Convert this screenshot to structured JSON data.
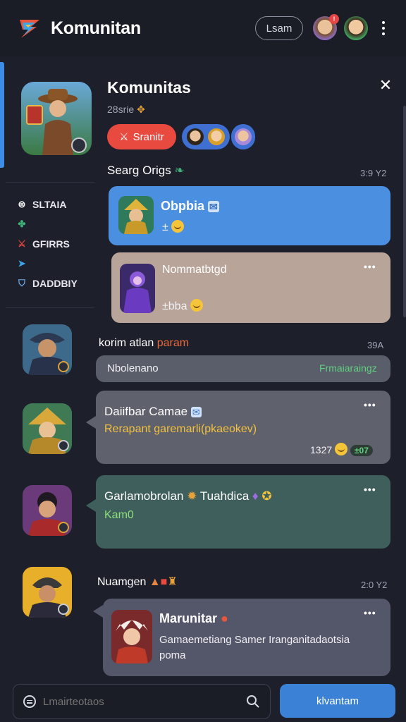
{
  "app": {
    "name": "Komunitan",
    "login_label": "Lsam",
    "notification_count": "!"
  },
  "community": {
    "title": "Komunitas",
    "subtitle": "28srie",
    "join_label": "Sranitr",
    "close_glyph": "✕"
  },
  "sidebar": {
    "items": [
      {
        "label": "SLTAIA",
        "icon": "coin-icon"
      },
      {
        "label": "",
        "icon": "clover-icon"
      },
      {
        "label": "GFIRRS",
        "icon": "sword-icon"
      },
      {
        "label": "",
        "icon": "arrow-icon"
      },
      {
        "label": "DADDBIY",
        "icon": "shield-icon"
      }
    ]
  },
  "section1": {
    "title": "Searg Origs",
    "time": "3:9 Y2"
  },
  "feed": {
    "card1": {
      "title": "Obpbia",
      "text": "±"
    },
    "card2": {
      "title": "Nommatbtgd",
      "text": "±bba"
    },
    "post3": {
      "author": "korim atlan",
      "author_tag": "param",
      "time": "39A",
      "text": "Nbolenano",
      "tag": "Frmaiaraingz"
    },
    "post4": {
      "title": "Daiifbar Camae",
      "text": "Rerapant garemarli(pkaeokev)",
      "meta": "1327",
      "badge": "±07"
    },
    "post5": {
      "title": "Garlamobrolan",
      "title_b": "Tuahdica",
      "text": "Kam0"
    },
    "post6": {
      "header": "Nuamgen",
      "time": "2:0 Y2",
      "title": "Marunitar",
      "text": "Gamaemetiang Samer Iranganitadaotsia poma"
    }
  },
  "bottom": {
    "search_placeholder": "Lmairteotaos",
    "send_label": "klvantam"
  },
  "colors": {
    "accent_blue": "#4a8fe0",
    "join_red": "#e94a3f",
    "background": "#1d1f2b"
  }
}
